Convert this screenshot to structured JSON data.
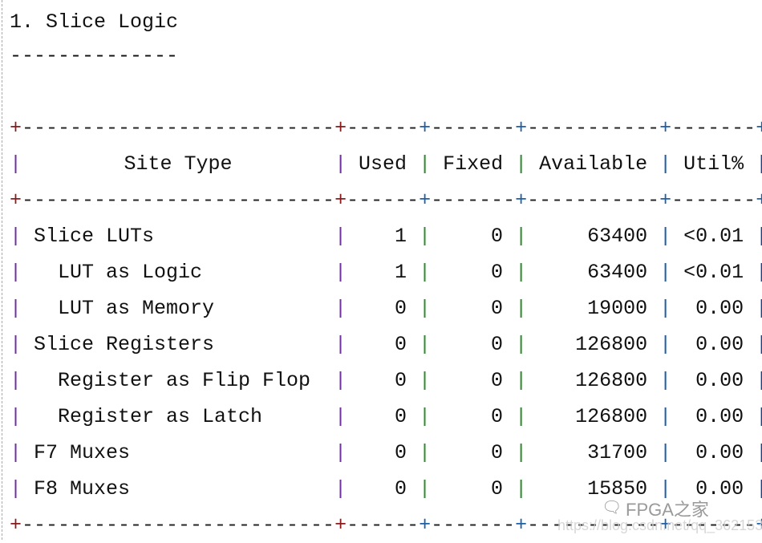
{
  "section_title": "1. Slice Logic",
  "underline": "--------------",
  "colors": {
    "pipe_site": "#7030a0",
    "pipe_used": "#7030a0",
    "pipe_fixed": "#2e8b2e",
    "pipe_avail": "#2e8b2e",
    "pipe_util": "#1f5fa8",
    "pipe_end": "#1f3f88",
    "plus_red": "#8b1a1a",
    "plus_blue": "#1f5fa8"
  },
  "headers": {
    "site": "Site Type",
    "used": "Used",
    "fixed": "Fixed",
    "available": "Available",
    "util": "Util%"
  },
  "rows": [
    {
      "site": "Slice LUTs",
      "indent": 0,
      "used": "1",
      "fixed": "0",
      "available": "63400",
      "util": "<0.01"
    },
    {
      "site": "LUT as Logic",
      "indent": 1,
      "used": "1",
      "fixed": "0",
      "available": "63400",
      "util": "<0.01"
    },
    {
      "site": "LUT as Memory",
      "indent": 1,
      "used": "0",
      "fixed": "0",
      "available": "19000",
      "util": "0.00"
    },
    {
      "site": "Slice Registers",
      "indent": 0,
      "used": "0",
      "fixed": "0",
      "available": "126800",
      "util": "0.00"
    },
    {
      "site": "Register as Flip Flop",
      "indent": 1,
      "used": "0",
      "fixed": "0",
      "available": "126800",
      "util": "0.00"
    },
    {
      "site": "Register as Latch",
      "indent": 1,
      "used": "0",
      "fixed": "0",
      "available": "126800",
      "util": "0.00"
    },
    {
      "site": "F7 Muxes",
      "indent": 0,
      "used": "0",
      "fixed": "0",
      "available": "31700",
      "util": "0.00"
    },
    {
      "site": "F8 Muxes",
      "indent": 0,
      "used": "0",
      "fixed": "0",
      "available": "15850",
      "util": "0.00"
    }
  ],
  "watermark": {
    "brand": "FPGA之家",
    "url": "https://blog.csdn.net/qq_36215315",
    "icon": "wechat-icon"
  }
}
